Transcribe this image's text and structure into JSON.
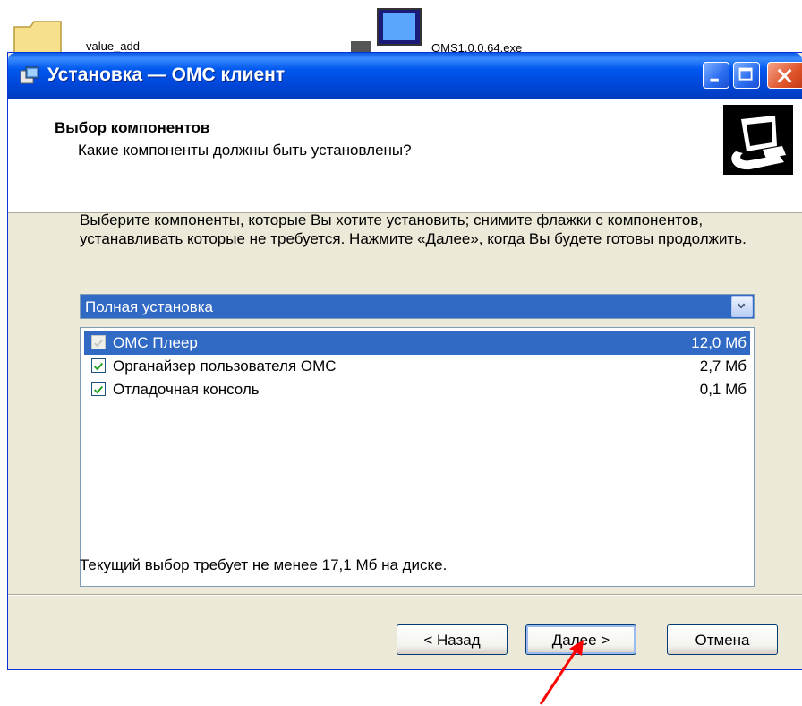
{
  "desktop": {
    "folder_label": "value_add",
    "exe_label": "OMS1.0.0.64.exe"
  },
  "window": {
    "title": "Установка — ОМС клиент",
    "icon": "setup-icon"
  },
  "header": {
    "title": "Выбор компонентов",
    "subtitle": "Какие компоненты должны быть установлены?",
    "image_icon": "computer-icon"
  },
  "instructions": "Выберите компоненты, которые Вы хотите установить; снимите флажки с компонентов, устанавливать которые не требуется. Нажмите «Далее», когда Вы будете готовы продолжить.",
  "install_type": {
    "selected": "Полная установка"
  },
  "components": [
    {
      "name": "ОМС Плеер",
      "size": "12,0 Мб",
      "checked": true,
      "disabled": true,
      "selected": true
    },
    {
      "name": "Органайзер пользователя ОМС",
      "size": "2,7 Мб",
      "checked": true,
      "disabled": false,
      "selected": false
    },
    {
      "name": "Отладочная консоль",
      "size": "0,1 Мб",
      "checked": true,
      "disabled": false,
      "selected": false
    }
  ],
  "disk_requirement": "Текущий выбор требует не менее 17,1 Мб на диске.",
  "buttons": {
    "back": "< Назад",
    "next": "Далее >",
    "cancel": "Отмена"
  },
  "colors": {
    "title_bar": "#0058ee",
    "selection": "#316ac5",
    "arrow": "#ff0000"
  }
}
